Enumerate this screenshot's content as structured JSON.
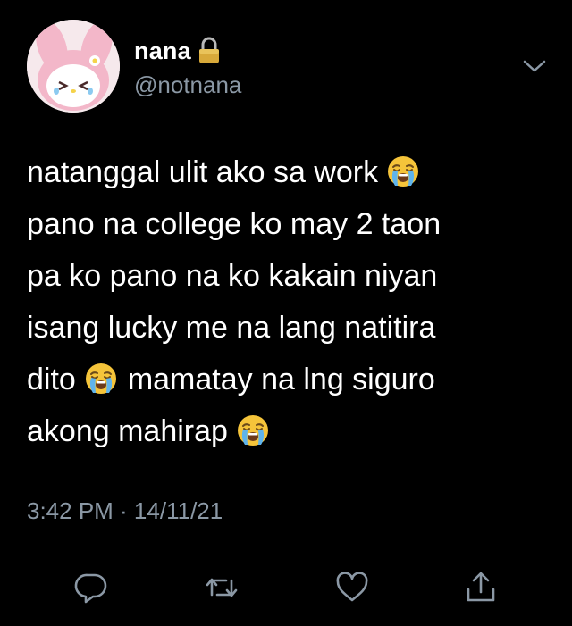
{
  "user": {
    "display_name": "nana",
    "handle": "@notnana",
    "avatar_icon": "my-melody-avatar",
    "protected_icon": "lock-icon"
  },
  "tweet": {
    "lines": [
      {
        "text": "natanggal ulit ako sa work",
        "emoji_after": true
      },
      {
        "text": "pano na college ko may 2 taon",
        "emoji_after": false
      },
      {
        "text": "pa ko pano na ko kakain niyan",
        "emoji_after": false
      },
      {
        "text": "isang lucky me na lang natitira",
        "emoji_after": false
      },
      {
        "text": "dito",
        "emoji_after": true,
        "text_after": "mamatay na lng siguro"
      },
      {
        "text": "akong mahirap",
        "emoji_after": true
      }
    ],
    "emoji": "loudly-crying-face",
    "timestamp": "3:42 PM · 14/11/21"
  },
  "actions": {
    "reply_icon": "reply-icon",
    "retweet_icon": "retweet-icon",
    "like_icon": "heart-icon",
    "share_icon": "share-icon"
  },
  "colors": {
    "background": "#000000",
    "text": "#ffffff",
    "secondary": "#8b98a5",
    "divider": "#38444d"
  }
}
